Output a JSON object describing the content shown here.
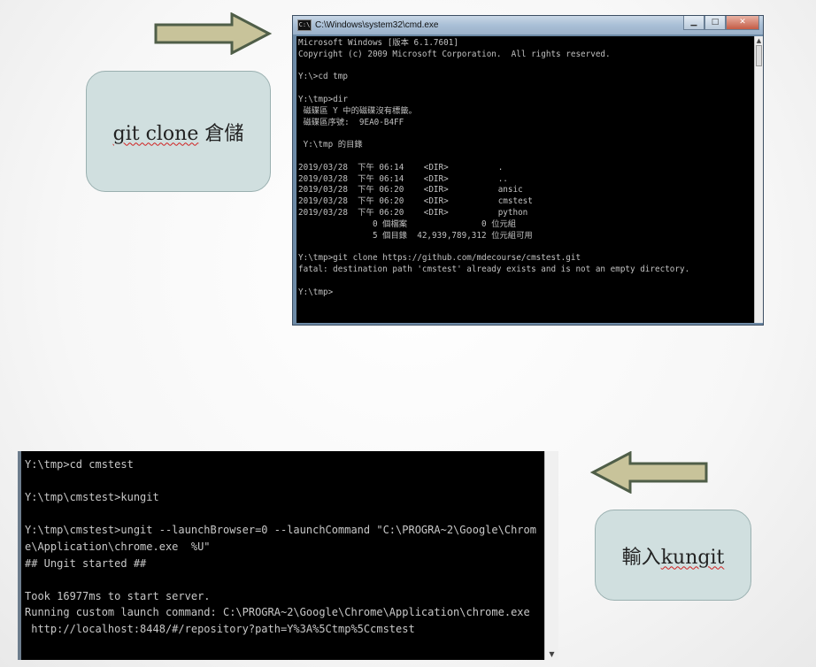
{
  "callout_top": {
    "text_prefix": "git clone",
    "text_suffix": "倉儲"
  },
  "callout_bottom": {
    "text_prefix": "輸入",
    "text_suffix": "kungit"
  },
  "window": {
    "title": "C:\\Windows\\system32\\cmd.exe",
    "buttons": {
      "minimize": "▁",
      "maximize": "□",
      "close": "✕"
    }
  },
  "console_top": {
    "lines": [
      "Microsoft Windows [版本 6.1.7601]",
      "Copyright (c) 2009 Microsoft Corporation.  All rights reserved.",
      "",
      "Y:\\>cd tmp",
      "",
      "Y:\\tmp>dir",
      " 磁碟區 Y 中的磁碟沒有標籤。",
      " 磁碟區序號:  9EA0-B4FF",
      "",
      " Y:\\tmp 的目錄",
      "",
      "2019/03/28  下午 06:14    <DIR>          .",
      "2019/03/28  下午 06:14    <DIR>          ..",
      "2019/03/28  下午 06:20    <DIR>          ansic",
      "2019/03/28  下午 06:20    <DIR>          cmstest",
      "2019/03/28  下午 06:20    <DIR>          python",
      "               0 個檔案               0 位元組",
      "               5 個目錄  42,939,789,312 位元組可用",
      "",
      "Y:\\tmp>git clone https://github.com/mdecourse/cmstest.git",
      "fatal: destination path 'cmstest' already exists and is not an empty directory.",
      "",
      "Y:\\tmp>"
    ]
  },
  "console_bottom": {
    "lines": [
      "Y:\\tmp>cd cmstest",
      "",
      "Y:\\tmp\\cmstest>kungit",
      "",
      "Y:\\tmp\\cmstest>ungit --launchBrowser=0 --launchCommand \"C:\\PROGRA~2\\Google\\Chrom",
      "e\\Application\\chrome.exe  %U\"",
      "## Ungit started ##",
      "",
      "Took 16977ms to start server.",
      "Running custom launch command: C:\\PROGRA~2\\Google\\Chrome\\Application\\chrome.exe",
      " http://localhost:8448/#/repository?path=Y%3A%5Ctmp%5Ccmstest"
    ]
  },
  "colors": {
    "callout_bg": "#d0dfdf",
    "arrow_fill": "#c8c39a",
    "arrow_stroke": "#5a6b52"
  }
}
